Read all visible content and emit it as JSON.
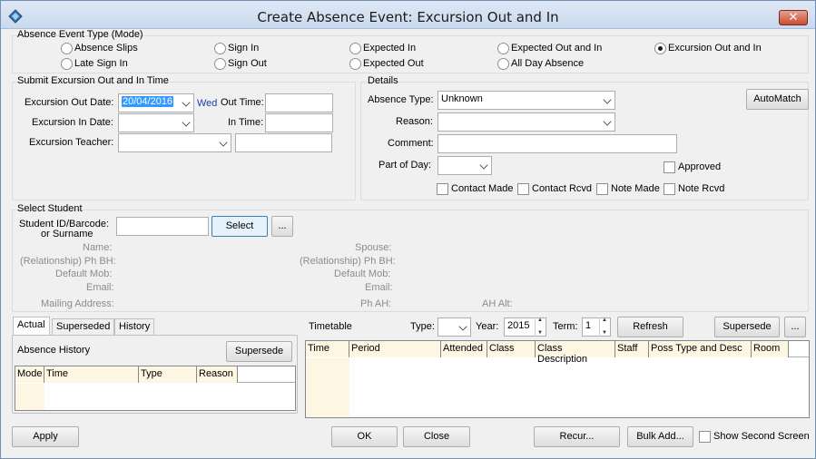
{
  "window": {
    "title": "Create Absence Event: Excursion Out and In",
    "close_label": "✕"
  },
  "mode": {
    "group_label": "Absence Event Type (Mode)",
    "options": [
      {
        "label": "Absence Slips",
        "selected": false
      },
      {
        "label": "Sign In",
        "selected": false
      },
      {
        "label": "Expected In",
        "selected": false
      },
      {
        "label": "Expected Out and In",
        "selected": false
      },
      {
        "label": "Excursion Out and In",
        "selected": true
      },
      {
        "label": "Late Sign In",
        "selected": false
      },
      {
        "label": "Sign Out",
        "selected": false
      },
      {
        "label": "Expected Out",
        "selected": false
      },
      {
        "label": "All Day Absence",
        "selected": false
      }
    ]
  },
  "submit": {
    "group_label": "Submit Excursion Out and In Time",
    "out_date_label": "Excursion Out Date:",
    "out_date_value": "20/04/2016",
    "day_text": "Wed",
    "out_time_label": "Out Time:",
    "in_date_label": "Excursion In Date:",
    "in_time_label": "In Time:",
    "teacher_label": "Excursion Teacher:"
  },
  "details": {
    "group_label": "Details",
    "absence_type_label": "Absence Type:",
    "absence_type_value": "Unknown",
    "automatch_label": "AutoMatch",
    "reason_label": "Reason:",
    "comment_label": "Comment:",
    "part_of_day_label": "Part of Day:",
    "approved_label": "Approved",
    "contact_made_label": "Contact Made",
    "contact_rcvd_label": "Contact Rcvd",
    "note_made_label": "Note Made",
    "note_rcvd_label": "Note Rcvd"
  },
  "student": {
    "group_label": "Select Student",
    "id_label_1": "Student ID/Barcode:",
    "id_label_2": "or Surname",
    "select_label": "Select",
    "more_label": "...",
    "name_label": "Name:",
    "ph_bh_label": "(Relationship) Ph BH:",
    "default_mob_label": "Default Mob:",
    "email_label": "Email:",
    "mailing_label": "Mailing Address:",
    "spouse_label": "Spouse:",
    "sp_ph_bh_label": "(Relationship) Ph BH:",
    "sp_default_mob_label": "Default Mob:",
    "sp_email_label": "Email:",
    "ph_ah_label": "Ph AH:",
    "ah_alt_label": "AH Alt:"
  },
  "tabs": [
    "Actual",
    "Superseded",
    "History"
  ],
  "history": {
    "label": "Absence History",
    "supersede_label": "Supersede",
    "columns": [
      "Mode",
      "Time",
      "Type",
      "Reason"
    ]
  },
  "timetable": {
    "label": "Timetable",
    "type_label": "Type:",
    "year_label": "Year:",
    "year_value": "2015",
    "term_label": "Term:",
    "term_value": "1",
    "refresh_label": "Refresh",
    "supersede_label": "Supersede",
    "more_label": "...",
    "columns": [
      "Time",
      "Period",
      "Attended",
      "Class",
      "Class Description",
      "Staff",
      "Poss Type and Desc",
      "Room"
    ]
  },
  "footer": {
    "apply_label": "Apply",
    "ok_label": "OK",
    "close_label": "Close",
    "recur_label": "Recur...",
    "bulk_add_label": "Bulk Add...",
    "show_second_label": "Show Second Screen"
  }
}
